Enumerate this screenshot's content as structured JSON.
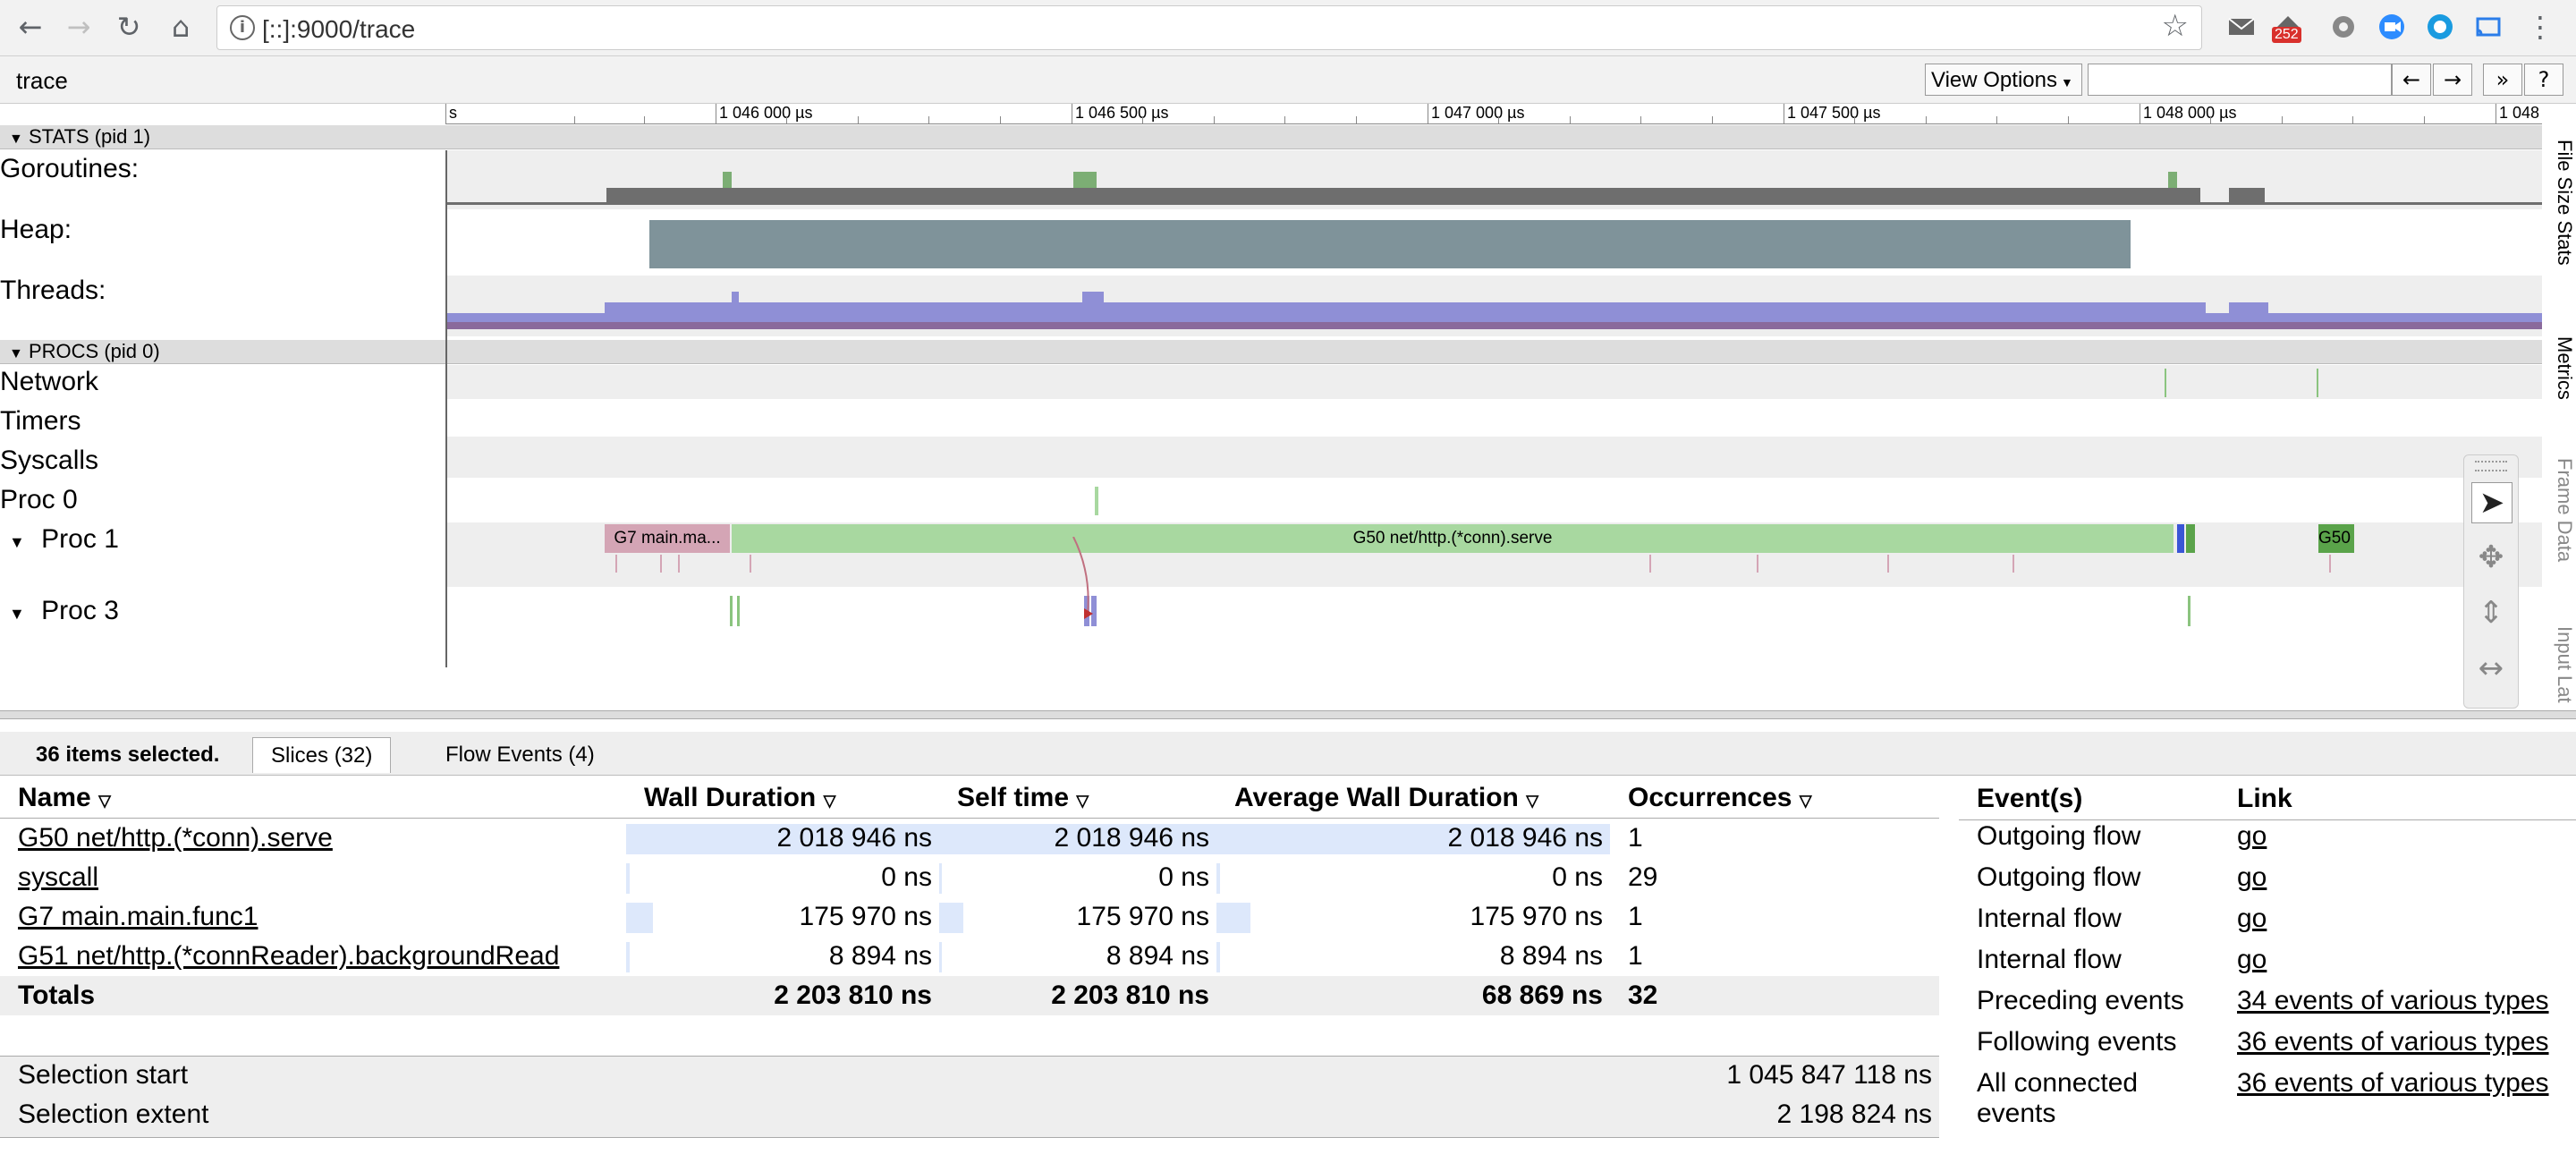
{
  "browser": {
    "url": "[::]:9000/trace",
    "notification_badge": "252",
    "icons": {
      "back": "back-arrow-icon",
      "forward": "forward-arrow-icon",
      "reload": "reload-icon",
      "home": "home-icon",
      "star": "bookmark-star-icon"
    }
  },
  "header": {
    "title": "trace",
    "view_options": "View Options",
    "search_placeholder": "",
    "prev": "←",
    "next": "→",
    "more": "»",
    "help": "?"
  },
  "ruler": {
    "labels": [
      "s",
      "1 046 000 µs",
      "1 046 500 µs",
      "1 047 000 µs",
      "1 047 500 µs",
      "1 048 000 µs",
      "1 048"
    ]
  },
  "stats": {
    "header": "STATS (pid 1)",
    "rows": [
      "Goroutines:",
      "Heap:",
      "Threads:"
    ]
  },
  "procs": {
    "header": "PROCS (pid 0)",
    "rows": [
      "Network",
      "Timers",
      "Syscalls",
      "Proc 0",
      "Proc 1",
      "Proc 3"
    ]
  },
  "slices": {
    "g7": "G7 main.ma...",
    "g50": "G50 net/http.(*conn).serve",
    "g50_short": "G50"
  },
  "side_tabs": [
    "File Size Stats",
    "Metrics",
    "Frame Data",
    "Input Lat"
  ],
  "analysis": {
    "selected_text": "36 items selected.",
    "tabs": [
      "Slices (32)",
      "Flow Events (4)"
    ],
    "columns": [
      "Name",
      "Wall Duration",
      "Self time",
      "Average Wall Duration",
      "Occurrences"
    ],
    "rows": [
      {
        "name": "G50 net/http.(*conn).serve",
        "wall": "2 018 946 ns",
        "self": "2 018 946 ns",
        "avg": "2 018 946 ns",
        "occ": "1",
        "frac": 1.0
      },
      {
        "name": "syscall",
        "wall": "0 ns",
        "self": "0 ns",
        "avg": "0 ns",
        "occ": "29",
        "frac": 0.0
      },
      {
        "name": "G7 main.main.func1",
        "wall": "175 970 ns",
        "self": "175 970 ns",
        "avg": "175 970 ns",
        "occ": "1",
        "frac": 0.087
      },
      {
        "name": "G51 net/http.(*connReader).backgroundRead",
        "wall": "8 894 ns",
        "self": "8 894 ns",
        "avg": "8 894 ns",
        "occ": "1",
        "frac": 0.004
      }
    ],
    "totals": {
      "label": "Totals",
      "wall": "2 203 810 ns",
      "self": "2 203 810 ns",
      "avg": "68 869 ns",
      "occ": "32"
    },
    "selection_start_label": "Selection start",
    "selection_start": "1 045 847 118 ns",
    "selection_extent_label": "Selection extent",
    "selection_extent": "2 198 824 ns",
    "events": {
      "columns": [
        "Event(s)",
        "Link"
      ],
      "rows": [
        {
          "event": "Outgoing flow",
          "link": "go"
        },
        {
          "event": "Outgoing flow",
          "link": "go"
        },
        {
          "event": "Internal flow",
          "link": "go"
        },
        {
          "event": "Internal flow",
          "link": "go"
        },
        {
          "event": "Preceding events",
          "link": "34 events of various types"
        },
        {
          "event": "Following events",
          "link": "36 events of various types"
        },
        {
          "event": "All connected events",
          "link": "36 events of various types"
        }
      ]
    }
  },
  "colors": {
    "goroutine_bar": "#6e6e6e",
    "heap_bar": "#7f939a",
    "thread_bar": "#8f8fd6",
    "thread_bar_dark": "#8a6a9c",
    "g50_slice": "#a8d8a0",
    "g7_slice": "#d4a5b5"
  }
}
